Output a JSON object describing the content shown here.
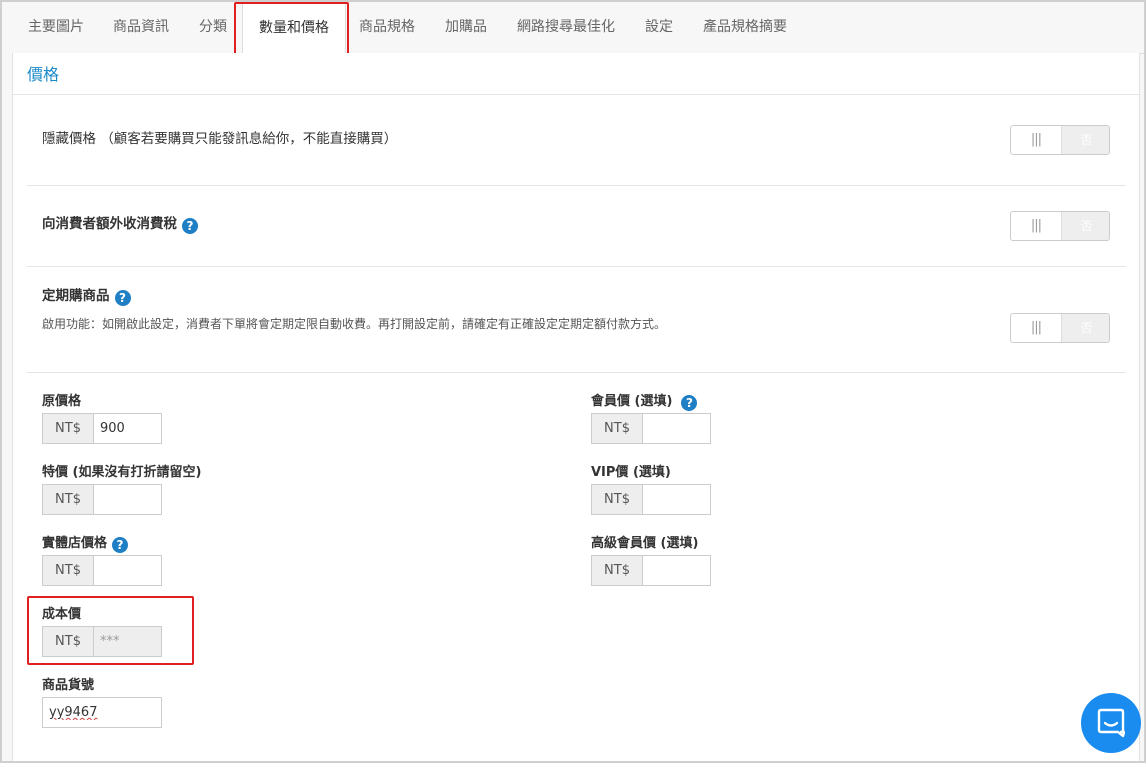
{
  "tabs": [
    {
      "label": "主要圖片"
    },
    {
      "label": "商品資訊"
    },
    {
      "label": "分類"
    },
    {
      "label": "數量和價格",
      "active": true
    },
    {
      "label": "商品規格"
    },
    {
      "label": "加購品"
    },
    {
      "label": "網路搜尋最佳化"
    },
    {
      "label": "設定"
    },
    {
      "label": "產品規格摘要"
    }
  ],
  "section_title": "價格",
  "toggles": {
    "hide_price": {
      "label": "隱藏價格 （顧客若要購買只能發訊息給你，不能直接購買）",
      "on_text": "|||",
      "off_text": "否",
      "state": "off"
    },
    "consumption_tax": {
      "label": "向消費者額外收消費稅",
      "on_text": "|||",
      "off_text": "否",
      "state": "off"
    },
    "subscription": {
      "label": "定期購商品",
      "description": "啟用功能：如開啟此設定，消費者下單將會定期定限自動收費。再打開設定前，請確定有正確設定定期定額付款方式。",
      "on_text": "|||",
      "off_text": "否",
      "state": "off"
    }
  },
  "icons": {
    "help": "?"
  },
  "fields": {
    "original_price": {
      "label": "原價格",
      "currency": "NT$",
      "value": "900"
    },
    "sale_price": {
      "label": "特價 (如果沒有打折請留空)",
      "currency": "NT$",
      "value": ""
    },
    "store_price": {
      "label": "實體店價格",
      "currency": "NT$",
      "value": ""
    },
    "cost_price": {
      "label": "成本價",
      "currency": "NT$",
      "value": "***"
    },
    "sku": {
      "label": "商品貨號",
      "value": "yy9467"
    },
    "member_price": {
      "label": "會員價 (選填)",
      "currency": "NT$",
      "value": ""
    },
    "vip_price": {
      "label": "VIP價 (選填)",
      "currency": "NT$",
      "value": ""
    },
    "premium_member_price": {
      "label": "高級會員價 (選填)",
      "currency": "NT$",
      "value": ""
    }
  },
  "colors": {
    "accent": "#1a8ac8",
    "highlight": "#e02020",
    "chat": "#1a8cf0"
  }
}
